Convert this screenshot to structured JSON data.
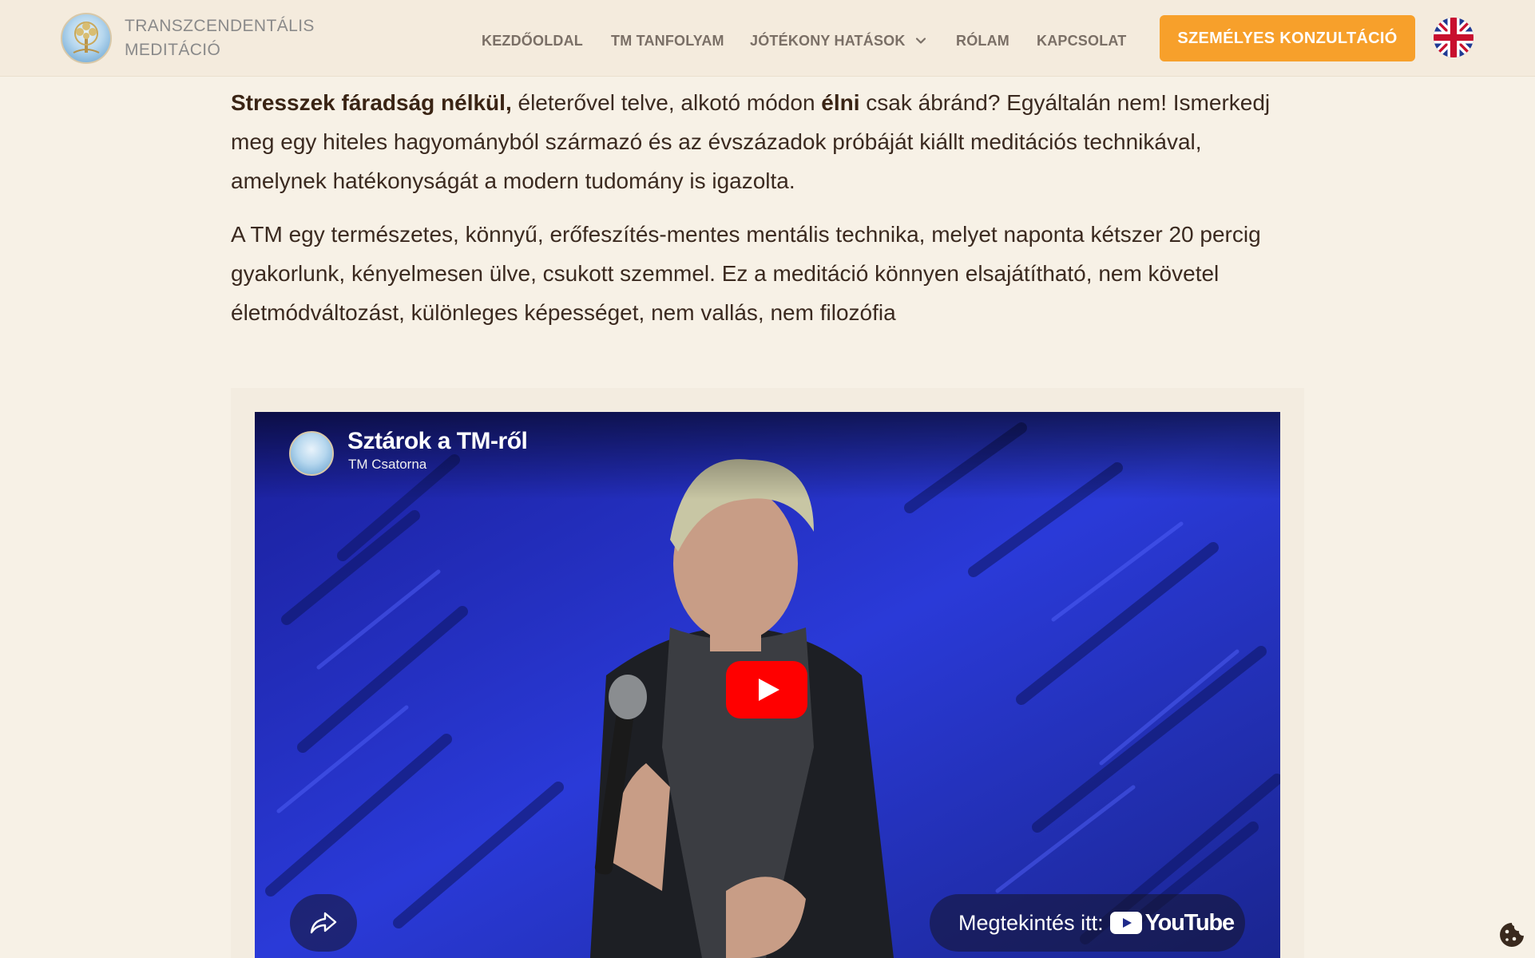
{
  "header": {
    "brand_line1": "TRANSZCENDENTÁLIS",
    "brand_line2": "MEDITÁCIÓ",
    "logo_icon": "tree-of-life-logo",
    "nav": {
      "home": "KEZDŐOLDAL",
      "course": "TM TANFOLYAM",
      "effects": "JÓTÉKONY HATÁSOK",
      "about": "RÓLAM",
      "contact": "KAPCSOLAT"
    },
    "cta_label": "SZEMÉLYES KONZULTÁCIÓ",
    "language_icon": "uk-flag-icon"
  },
  "content": {
    "p1_bold1": "Stresszek fáradság nélkül,",
    "p1_text1": " életerővel telve, alkotó módon ",
    "p1_bold2": "élni",
    "p1_text2": " csak ábránd? Egyáltalán nem! Ismerkedj meg egy hiteles hagyományból származó és az évszázadok próbáját kiállt meditációs technikával, amelynek hatékonyságát a modern tudomány is igazolta.",
    "p2": "A TM egy természetes, könnyű, erőfeszítés-mentes mentális technika, melyet naponta kétszer 20 percig gyakorlunk, kényelmesen ülve, csukott szemmel. Ez a meditáció könnyen elsajátítható, nem követel életmódváltozást, különleges képességet, nem vallás, nem filozófia"
  },
  "video": {
    "title": "Sztárok a TM-ről",
    "channel": "TM Csatorna",
    "watch_on_label": "Megtekintés itt:",
    "platform_name": "YouTube"
  },
  "colors": {
    "accent": "#f7a02b",
    "background": "#f7f1e6",
    "header_bg": "#f4ebdd",
    "nav_text": "#7a6f66",
    "youtube_red": "#ff0000"
  }
}
